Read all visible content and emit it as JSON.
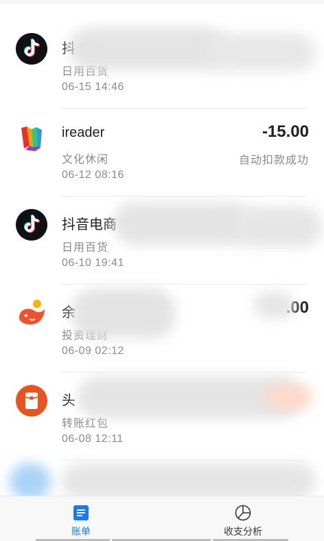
{
  "transactions": [
    {
      "icon": "tiktok-icon",
      "title": "抖",
      "category": "日用百货",
      "time": "06-15  14:46",
      "amount": "",
      "status": ""
    },
    {
      "icon": "ireader-icon",
      "title": "ireader",
      "category": "文化休闲",
      "time": "06-12  08:16",
      "amount": "-15.00",
      "status": "自动扣款成功"
    },
    {
      "icon": "tiktok-icon",
      "title": "抖音电商",
      "category": "日用百货",
      "time": "06-10  19:41",
      "amount": "",
      "status": ""
    },
    {
      "icon": "yuebao-icon",
      "title": "余",
      "category": "投资理财",
      "time": "06-09  02:12",
      "amount": ".00",
      "status": ""
    },
    {
      "icon": "red-envelope-icon",
      "title": "头",
      "category": "转账红包",
      "time": "06-08  12:11",
      "amount": "",
      "status": ""
    }
  ],
  "tabbar": {
    "bill_label": "账单",
    "analysis_label": "收支分析"
  },
  "colors": {
    "accent": "#1677ff",
    "tiktok_bg": "#111111",
    "yuebao": "#f2502a",
    "red_envelope": "#e8531f"
  }
}
